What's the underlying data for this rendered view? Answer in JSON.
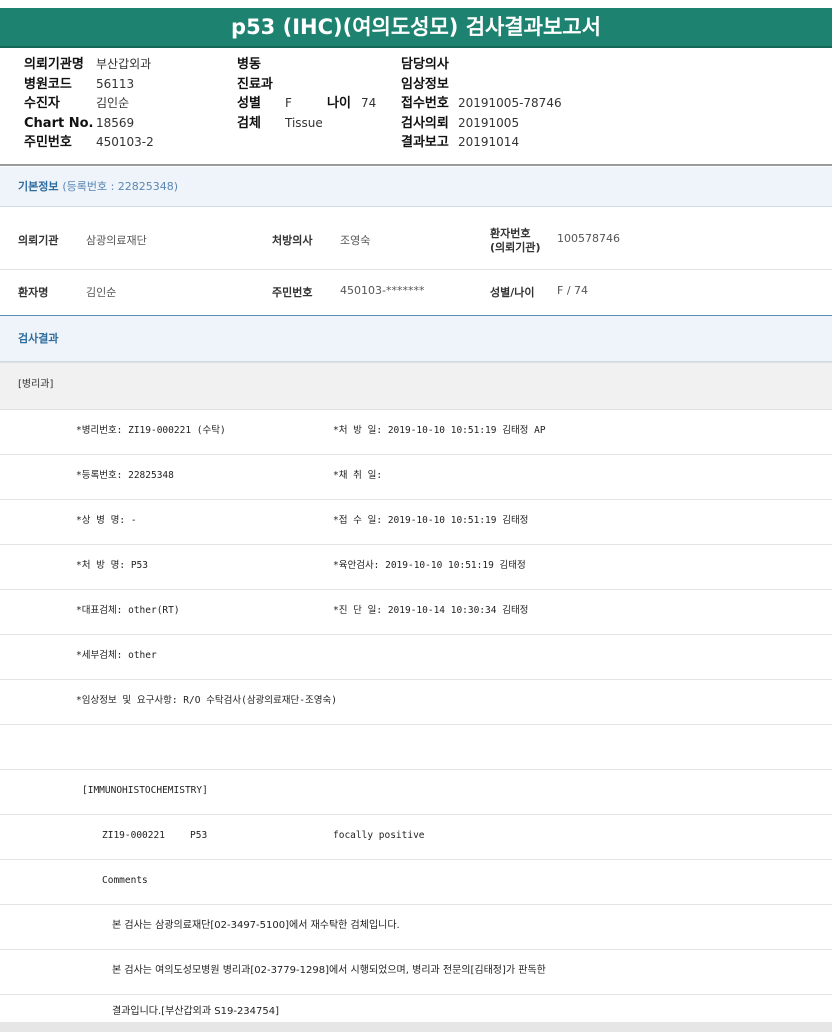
{
  "title": "p53 (IHC)(여의도성모) 검사결과보고서",
  "header": {
    "col1": [
      {
        "label": "의뢰기관명",
        "value": "부산갑외과"
      },
      {
        "label": "병원코드",
        "value": "56113"
      },
      {
        "label": "수진자",
        "value": "김인순"
      },
      {
        "label": "Chart No.",
        "value": "18569"
      },
      {
        "label": "주민번호",
        "value": "450103-2"
      }
    ],
    "col2": [
      {
        "label": "병동",
        "value": ""
      },
      {
        "label": "진료과",
        "value": ""
      },
      {
        "label": "성별",
        "value": "F"
      },
      {
        "label": "검체",
        "value": "Tissue"
      }
    ],
    "age": {
      "label": "나이",
      "value": "74"
    },
    "col3": [
      {
        "label": "담당의사",
        "value": ""
      },
      {
        "label": "임상정보",
        "value": ""
      },
      {
        "label": "접수번호",
        "value": "20191005-78746"
      },
      {
        "label": "검사의뢰",
        "value": "20191005"
      },
      {
        "label": "결과보고",
        "value": "20191014"
      }
    ]
  },
  "basic": {
    "title": "기본정보",
    "reg": "(등록번호 : 22825348)",
    "row1": {
      "l1": "의뢰기관",
      "v1": "삼광의료재단",
      "l2": "처방의사",
      "v2": "조영숙",
      "l3a": "환자번호",
      "l3b": "(의뢰기관)",
      "v3": "100578746"
    },
    "row2": {
      "l1": "환자명",
      "v1": "김인순",
      "l2": "주민번호",
      "v2": "450103-*******",
      "l3": "성별/나이",
      "v3": "F / 74"
    }
  },
  "result": {
    "title": "검사결과",
    "dept": "[병리과]",
    "lines": [
      {
        "left": "*병리번호: ZI19-000221 (수탁)",
        "right": "*처 방 일: 2019-10-10 10:51:19  김태정 AP"
      },
      {
        "left": "*등록번호: 22825348",
        "right": "*채 취 일:"
      },
      {
        "left": "*상 병 명: -",
        "right": "*접 수 일: 2019-10-10 10:51:19  김태정"
      },
      {
        "left": "*처 방 명: P53",
        "right": "*육안검사: 2019-10-10 10:51:19  김태정"
      },
      {
        "left": "*대표검체: other(RT)",
        "right": "*진 단 일: 2019-10-14 10:30:34  김태정"
      },
      {
        "left": "*세부검체: other",
        "right": ""
      },
      {
        "left": "*임상정보 및 요구사항: R/O 수탁검사(삼광의료재단-조영숙)",
        "right": ""
      }
    ],
    "ihc_header": "[IMMUNOHISTOCHEMISTRY]",
    "ihc": {
      "id": "ZI19-000221",
      "marker": "P53",
      "value": "focally positive"
    },
    "comments_label": "Comments",
    "comment1": "본 검사는 삼광의료재단[02-3497-5100]에서 재수탁한 검체입니다.",
    "comment2": "본 검사는 여의도성모병원 병리과[02-3779-1298]에서 시행되었으며, 병리과 전문의[김태정]가 판독한",
    "comment3": "결과입니다.[부산갑외과 S19-234754]"
  }
}
